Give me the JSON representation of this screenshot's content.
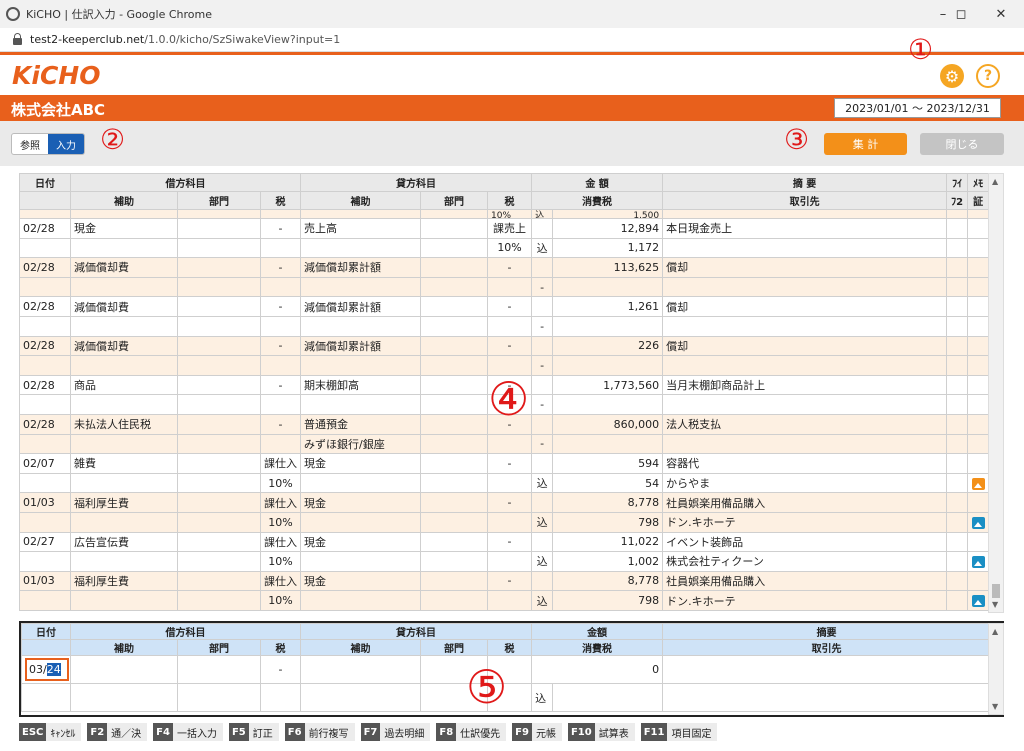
{
  "window": {
    "title": "KiCHO | 仕訳入力 - Google Chrome",
    "url_host": "test2-keeperclub.net",
    "url_path": "/1.0.0/kicho/SzSiwakeView?input=1"
  },
  "header": {
    "logo": "KiCHO",
    "company": "株式会社ABC",
    "date_range": "2023/01/01 ～ 2023/12/31"
  },
  "toolbar": {
    "mode_ref": "参照",
    "mode_input": "入力",
    "sum_button": "集 計",
    "close_button": "閉じる"
  },
  "annotations": {
    "a1": "①",
    "a2": "②",
    "a3": "③",
    "a4": "④",
    "a5": "⑤"
  },
  "grid_header": {
    "row1": [
      "日付",
      "借方科目",
      "貸方科目",
      "金 額",
      "摘 要",
      "ﾌｲ",
      "ﾒﾓ"
    ],
    "row2": [
      "補助",
      "部門",
      "税",
      "補助",
      "部門",
      "税",
      "消費税",
      "取引先",
      "ﾌ2",
      "証"
    ]
  },
  "entries": [
    {
      "date": "02/28",
      "debit": "現金",
      "dtax": "-",
      "credit": "売上高",
      "ctax": "課売上",
      "amount": "12,894",
      "memo": "本日現金売上",
      "sub_ctax": "10%",
      "sub_flag": "込",
      "sub_amount": "1,172",
      "sub_memo": "",
      "shade": false,
      "photo": false
    },
    {
      "date": "02/28",
      "debit": "減価償却費",
      "dtax": "-",
      "credit": "減価償却累計額",
      "ctax": "-",
      "amount": "113,625",
      "memo": "償却",
      "sub_flag": "-",
      "shade": true,
      "photo": false
    },
    {
      "date": "02/28",
      "debit": "減価償却費",
      "dtax": "-",
      "credit": "減価償却累計額",
      "ctax": "-",
      "amount": "1,261",
      "memo": "償却",
      "sub_flag": "-",
      "shade": false,
      "photo": false
    },
    {
      "date": "02/28",
      "debit": "減価償却費",
      "dtax": "-",
      "credit": "減価償却累計額",
      "ctax": "-",
      "amount": "226",
      "memo": "償却",
      "sub_flag": "-",
      "shade": true,
      "photo": false
    },
    {
      "date": "02/28",
      "debit": "商品",
      "dtax": "-",
      "credit": "期末棚卸高",
      "ctax": "-",
      "amount": "1,773,560",
      "memo": "当月末棚卸商品計上",
      "sub_flag": "-",
      "shade": false,
      "photo": false
    },
    {
      "date": "02/28",
      "debit": "未払法人住民税",
      "dtax": "-",
      "credit": "普通預金",
      "ctax": "-",
      "amount": "860,000",
      "memo": "法人税支払",
      "sub_credit": "みずほ銀行/銀座",
      "sub_flag": "-",
      "shade": true,
      "photo": false
    },
    {
      "date": "02/07",
      "debit": "雑費",
      "dtax": "課仕入",
      "credit": "現金",
      "ctax": "-",
      "amount": "594",
      "memo": "容器代",
      "sub_dtax": "10%",
      "sub_flag": "込",
      "sub_amount": "54",
      "sub_memo": "からやま",
      "shade": false,
      "photo": true,
      "photo_color": "#f39019"
    },
    {
      "date": "01/03",
      "debit": "福利厚生費",
      "dtax": "課仕入",
      "credit": "現金",
      "ctax": "-",
      "amount": "8,778",
      "memo": "社員娯楽用備品購入",
      "sub_dtax": "10%",
      "sub_flag": "込",
      "sub_amount": "798",
      "sub_memo": "ドン.キホーテ",
      "shade": true,
      "photo": true,
      "photo_color": "#1a8fc4"
    },
    {
      "date": "02/27",
      "debit": "広告宣伝費",
      "dtax": "課仕入",
      "credit": "現金",
      "ctax": "-",
      "amount": "11,022",
      "memo": "イベント装飾品",
      "sub_dtax": "10%",
      "sub_flag": "込",
      "sub_amount": "1,002",
      "sub_memo": "株式会社ティクーン",
      "shade": false,
      "photo": true,
      "photo_color": "#1a8fc4"
    },
    {
      "date": "01/03",
      "debit": "福利厚生費",
      "dtax": "課仕入",
      "credit": "現金",
      "ctax": "-",
      "amount": "8,778",
      "memo": "社員娯楽用備品購入",
      "sub_dtax": "10%",
      "sub_flag": "込",
      "sub_amount": "798",
      "sub_memo": "ドン.キホーテ",
      "shade": true,
      "photo": true,
      "photo_color": "#1a8fc4"
    }
  ],
  "partial_top": {
    "ctax": "10%",
    "flag": "込",
    "amount": "1,500"
  },
  "input_header": {
    "row1": [
      "日付",
      "借方科目",
      "貸方科目",
      "金額",
      "摘要"
    ],
    "row2": [
      "補助",
      "部門",
      "税",
      "補助",
      "部門",
      "税",
      "消費税",
      "取引先"
    ]
  },
  "input_row": {
    "date_prefix": "03/",
    "date_selected": "24",
    "dtax": "-",
    "amount": "0",
    "flag": "込"
  },
  "fkeys": [
    {
      "key": "ESC",
      "label": "ｷｬﾝｾﾙ"
    },
    {
      "key": "F2",
      "label": "通／決"
    },
    {
      "key": "F4",
      "label": "一括入力"
    },
    {
      "key": "F5",
      "label": "訂正"
    },
    {
      "key": "F6",
      "label": "前行複写"
    },
    {
      "key": "F7",
      "label": "過去明細"
    },
    {
      "key": "F8",
      "label": "仕訳優先"
    },
    {
      "key": "F9",
      "label": "元帳"
    },
    {
      "key": "F10",
      "label": "試算表"
    },
    {
      "key": "F11",
      "label": "項目固定"
    }
  ]
}
